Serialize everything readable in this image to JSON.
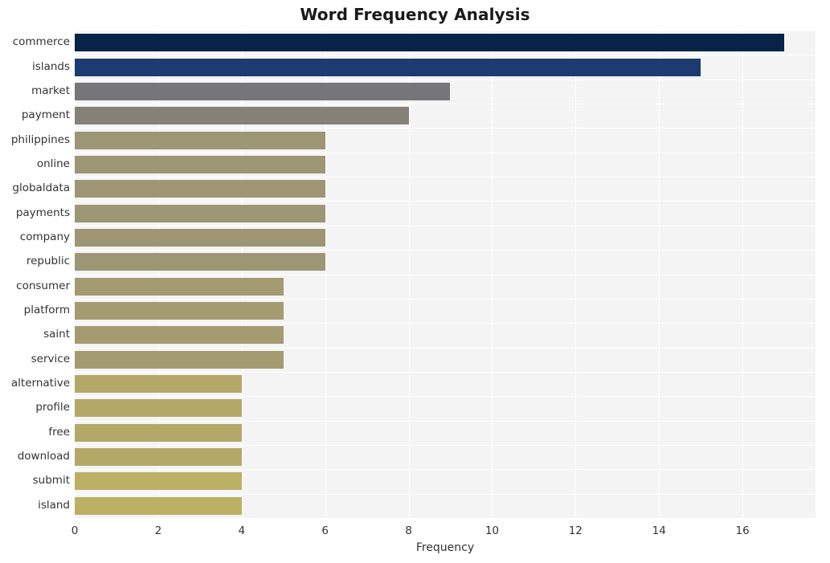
{
  "chart_data": {
    "type": "bar",
    "orientation": "horizontal",
    "title": "Word Frequency Analysis",
    "xlabel": "Frequency",
    "ylabel": "",
    "categories": [
      "commerce",
      "islands",
      "market",
      "payment",
      "philippines",
      "online",
      "globaldata",
      "payments",
      "company",
      "republic",
      "consumer",
      "platform",
      "saint",
      "service",
      "alternative",
      "profile",
      "free",
      "download",
      "submit",
      "island"
    ],
    "values": [
      17,
      15,
      9,
      8,
      6,
      6,
      6,
      6,
      6,
      6,
      5,
      5,
      5,
      5,
      4,
      4,
      4,
      4,
      4,
      4
    ],
    "bar_colors": [
      "#062348",
      "#1d3b71",
      "#75757a",
      "#858179",
      "#9c9674",
      "#9c9674",
      "#9c9674",
      "#9c9674",
      "#9c9674",
      "#9c9674",
      "#a59b70",
      "#a59b70",
      "#a59b70",
      "#a59b70",
      "#b4a869",
      "#b4a869",
      "#b4a869",
      "#b4a869",
      "#bcb065",
      "#bcb065"
    ],
    "xlim": [
      0,
      17.75
    ],
    "xticks": [
      0,
      2,
      4,
      6,
      8,
      10,
      12,
      14,
      16
    ],
    "xtick_labels": [
      "0",
      "2",
      "4",
      "6",
      "8",
      "10",
      "12",
      "14",
      "16"
    ],
    "grid": true,
    "grid_color": "#ffffff",
    "plot_background": "#f4f4f5",
    "figure_background": "#ffffff",
    "legend": null
  }
}
